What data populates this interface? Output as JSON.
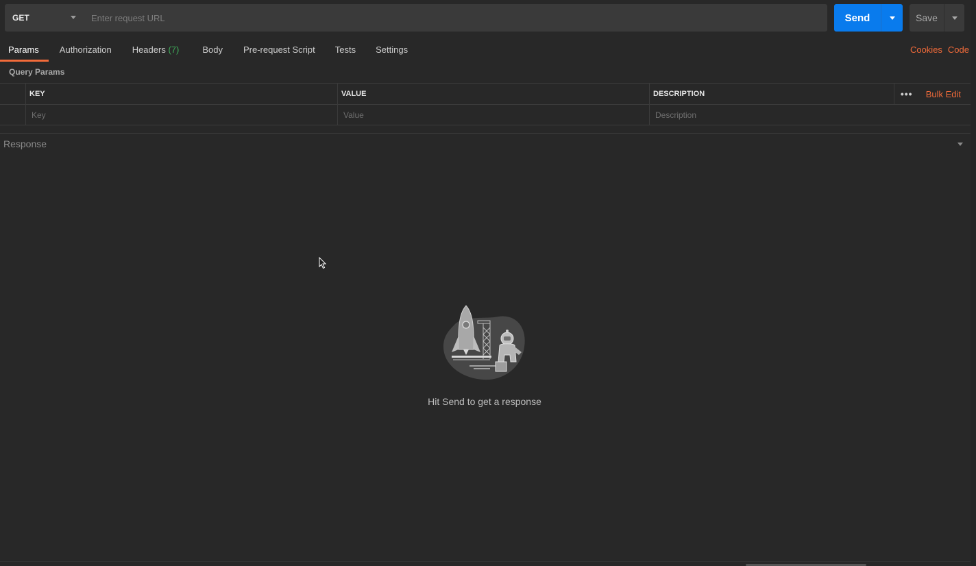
{
  "request": {
    "method": "GET",
    "url_placeholder": "Enter request URL",
    "url_value": ""
  },
  "actions": {
    "send_label": "Send",
    "save_label": "Save"
  },
  "tabs": [
    {
      "label": "Params",
      "active": true
    },
    {
      "label": "Authorization"
    },
    {
      "label": "Headers",
      "count": "(7)"
    },
    {
      "label": "Body"
    },
    {
      "label": "Pre-request Script"
    },
    {
      "label": "Tests"
    },
    {
      "label": "Settings"
    }
  ],
  "links": {
    "cookies": "Cookies",
    "code": "Code"
  },
  "query_params": {
    "section_label": "Query Params",
    "columns": [
      "KEY",
      "VALUE",
      "DESCRIPTION"
    ],
    "bulk_edit": "Bulk Edit",
    "more_glyph": "•••",
    "placeholders": {
      "key": "Key",
      "value": "Value",
      "description": "Description"
    }
  },
  "response": {
    "title": "Response",
    "empty_message": "Hit Send to get a response"
  },
  "colors": {
    "accent": "#f26b3a",
    "send": "#097bed",
    "count": "#3fae5a"
  }
}
